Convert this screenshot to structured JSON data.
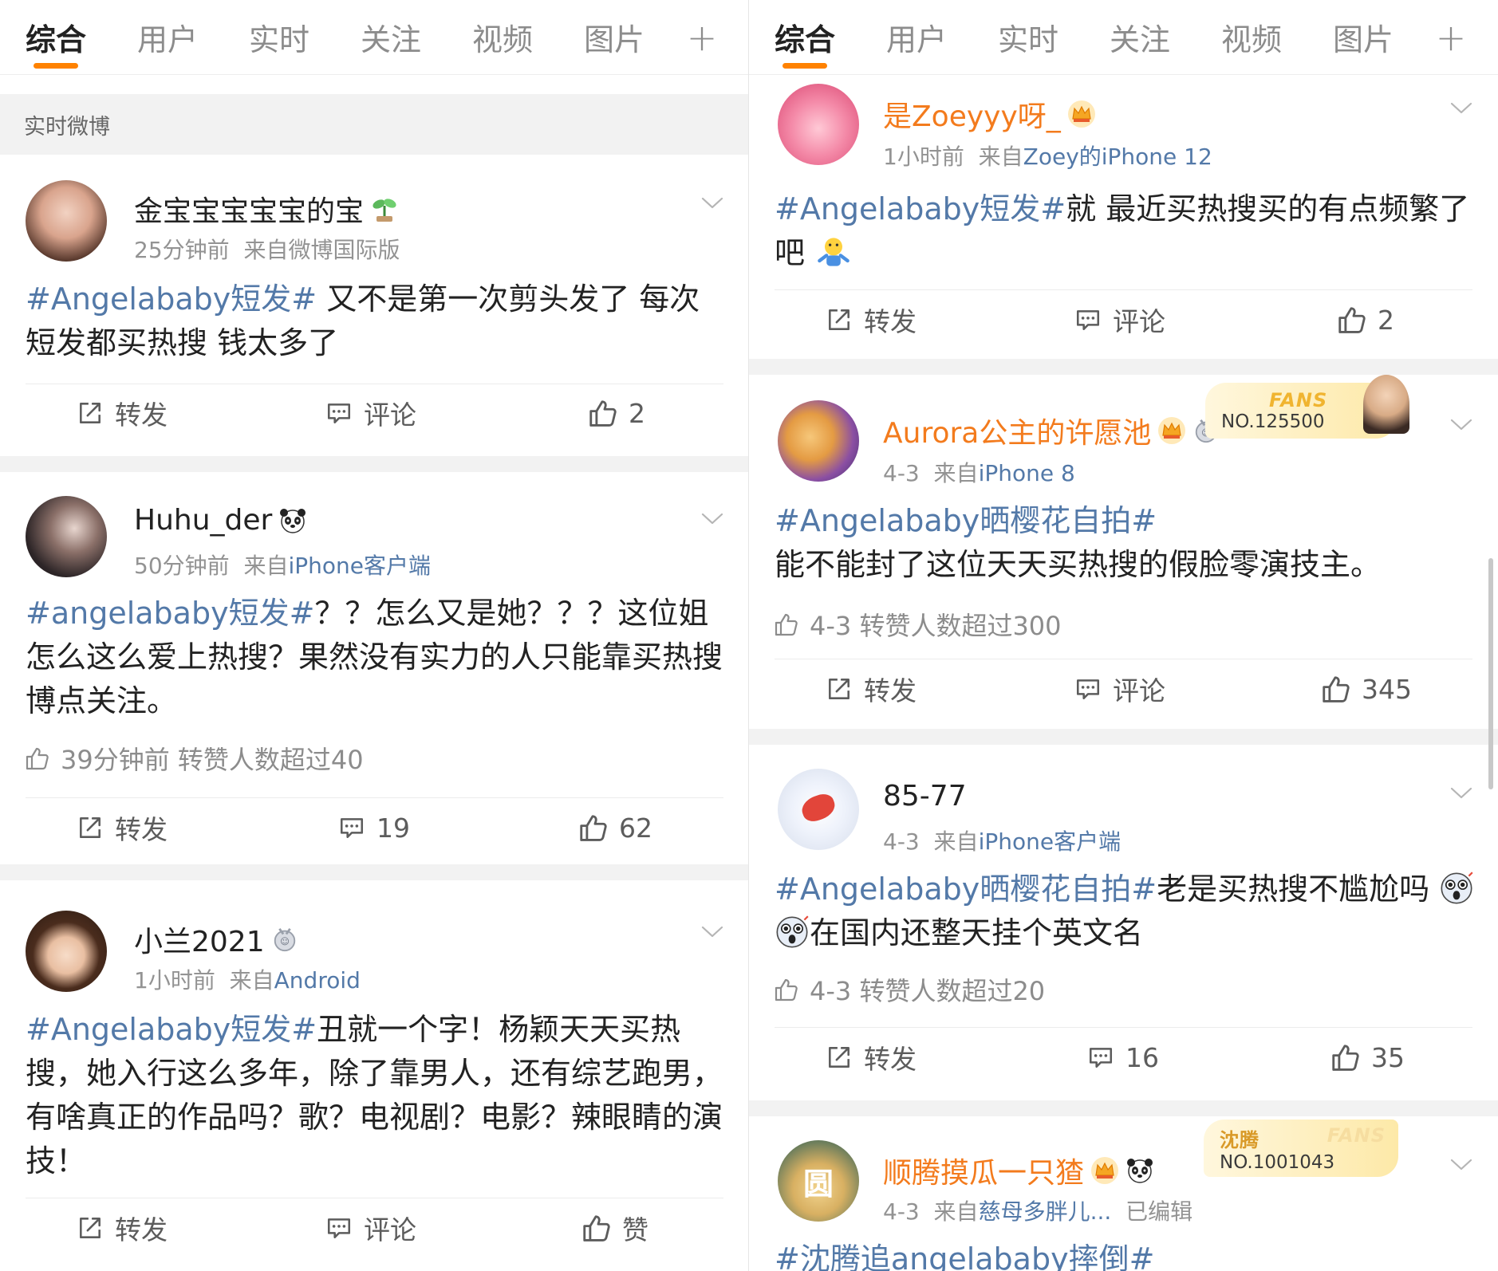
{
  "tabs": {
    "items": [
      "综合",
      "用户",
      "实时",
      "关注",
      "视频",
      "图片"
    ],
    "plus": "+"
  },
  "section_label": "实时微博",
  "actions": {
    "repost": "转发",
    "comment": "评论",
    "like": "赞"
  },
  "left_posts": [
    {
      "username": "金宝宝宝宝宝的宝",
      "time": "25分钟前",
      "from": "来自",
      "source": "微博国际版",
      "tag": "#Angelababy短发#",
      "text": " 又不是第一次剪头发了 每次短发都买热搜 钱太多了",
      "comment": "评论",
      "likes": "2"
    },
    {
      "username": "Huhu_der",
      "time": "50分钟前",
      "from": "来自",
      "source": "iPhone客户端",
      "tag": "#angelababy短发#",
      "text": "？？怎么又是她？？？这位姐怎么这么爱上热搜？果然没有实力的人只能靠买热搜博点关注。",
      "hotline": "39分钟前 转赞人数超过40",
      "comment": "19",
      "likes": "62"
    },
    {
      "username": "小兰2021",
      "time": "1小时前",
      "from": "来自",
      "source": "Android",
      "tag": "#Angelababy短发#",
      "text": "丑就一个字！杨颖天天买热搜，她入行这么多年，除了靠男人，还有综艺跑男，有啥真正的作品吗？歌？电视剧？电影？辣眼睛的演技！",
      "comment": "评论",
      "likes": "赞"
    }
  ],
  "right_posts": [
    {
      "username": "是Zoeyyy呀_",
      "time": "1小时前",
      "from": "来自",
      "source": "Zoey的iPhone 12",
      "tag": "#Angelababy短发#",
      "text": "就 最近买热搜买的有点频繁了吧",
      "comment": "评论",
      "likes": "2"
    },
    {
      "username": "Aurora公主的许愿池",
      "time": "4-3",
      "from": "来自",
      "source": "iPhone 8",
      "fans_label": "FANS",
      "fans_no": "NO.125500",
      "tag": "#Angelababy晒樱花自拍#",
      "text": "能不能封了这位天天买热搜的假脸零演技主。",
      "hotline": "4-3 转赞人数超过300",
      "comment": "评论",
      "likes": "345"
    },
    {
      "username": "85-77",
      "time": "4-3",
      "from": "来自",
      "source": "iPhone客户端",
      "tag": "#Angelababy晒樱花自拍#",
      "text": "老是买热搜不尴尬吗",
      "text2": "在国内还整天挂个英文名",
      "hotline": "4-3 转赞人数超过20",
      "comment": "16",
      "likes": "35"
    },
    {
      "username": "顺腾摸瓜一只猹",
      "time": "4-3",
      "from": "来自",
      "source": "慈母多胖儿...",
      "edited": "已编辑",
      "fans_label": "沈腾",
      "fans_label2": "FANS",
      "fans_no": "NO.1001043",
      "tag": "#沈腾追angelababy摔倒#",
      "avatar_char": "圆"
    }
  ],
  "colors": {
    "accent": "#ff8200",
    "link": "#5379a8",
    "vip_name": "#f37b1d",
    "meta": "#939393",
    "separator": "#f2f2f2"
  },
  "icons": {
    "repost": "repost-icon",
    "comment": "comment-icon",
    "like": "thumb-up-icon",
    "chevron": "chevron-down-icon"
  }
}
